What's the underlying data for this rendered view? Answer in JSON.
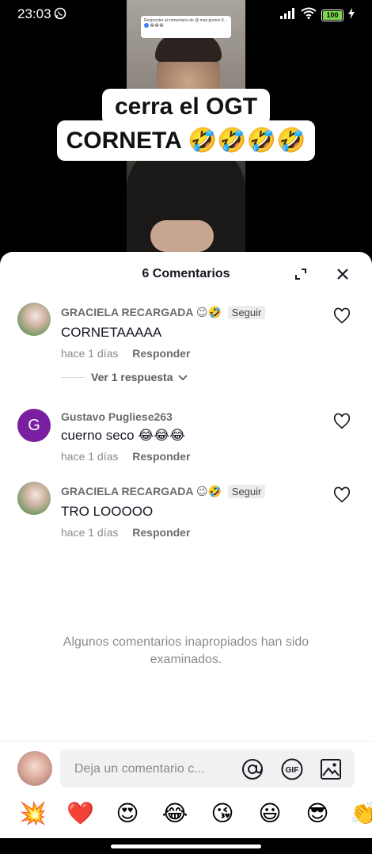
{
  "status": {
    "time": "23:03",
    "battery": "100"
  },
  "video": {
    "reply_sticker": "Responder al comentario de @ mas gomes K...",
    "caption_line1": "cerra el OGT",
    "caption_line2": "CORNETA 🤣🤣🤣🤣"
  },
  "sheet": {
    "title": "6 Comentarios",
    "comments": [
      {
        "user": "GRACIELA RECARGADA",
        "user_emoji": "😉🤣",
        "follow": "Seguir",
        "text": "CORNETAAAAA",
        "time": "hace 1 días",
        "reply": "Responder",
        "replies_label": "Ver 1 respuesta"
      },
      {
        "user": "Gustavo Pugliese263",
        "avatar_letter": "G",
        "text": "cuerno seco 😂😂😂",
        "time": "hace 1 días",
        "reply": "Responder"
      },
      {
        "user": "GRACIELA RECARGADA",
        "user_emoji": "😉🤣",
        "follow": "Seguir",
        "text": "TRO LOOOOO",
        "time": "hace 1 días",
        "reply": "Responder"
      }
    ],
    "notice": "Algunos comentarios inapropiados han sido examinados.",
    "input_placeholder": "Deja un comentario c..."
  },
  "emoji_bar": [
    "💥",
    "❤️",
    "😍",
    "😂",
    "😘",
    "😃",
    "😎",
    "👏"
  ]
}
